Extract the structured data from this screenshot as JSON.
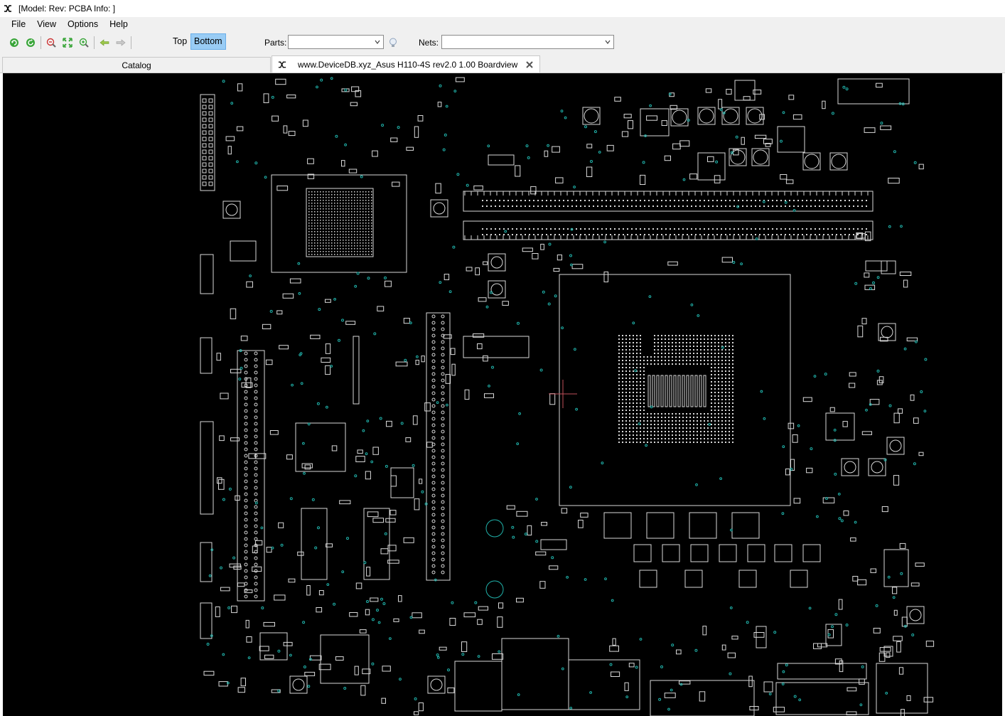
{
  "window": {
    "title": "[Model: Rev:  PCBA Info: ]"
  },
  "menu": {
    "items": [
      "File",
      "View",
      "Options",
      "Help"
    ]
  },
  "toolbar": {
    "buttons": [
      "refresh-icon",
      "rotate-icon",
      "zoom-out-icon",
      "fit-icon",
      "zoom-in-icon",
      "back-arrow-icon",
      "forward-arrow-icon"
    ],
    "top_label": "Top",
    "bottom_label": "Bottom",
    "active_side": "Bottom",
    "parts_label": "Parts:",
    "parts_value": "",
    "nets_label": "Nets:",
    "nets_value": ""
  },
  "tabs": {
    "catalog": "Catalog",
    "document": "www.DeviceDB.xyz_Asus H110-4S rev2.0 1.00 Boardview"
  },
  "colors": {
    "board_background": "#000000",
    "outline": "#d9d9d9",
    "pin_accent": "#20b2aa",
    "cursor": "#c0505a",
    "active_button": "#99ccf5"
  }
}
